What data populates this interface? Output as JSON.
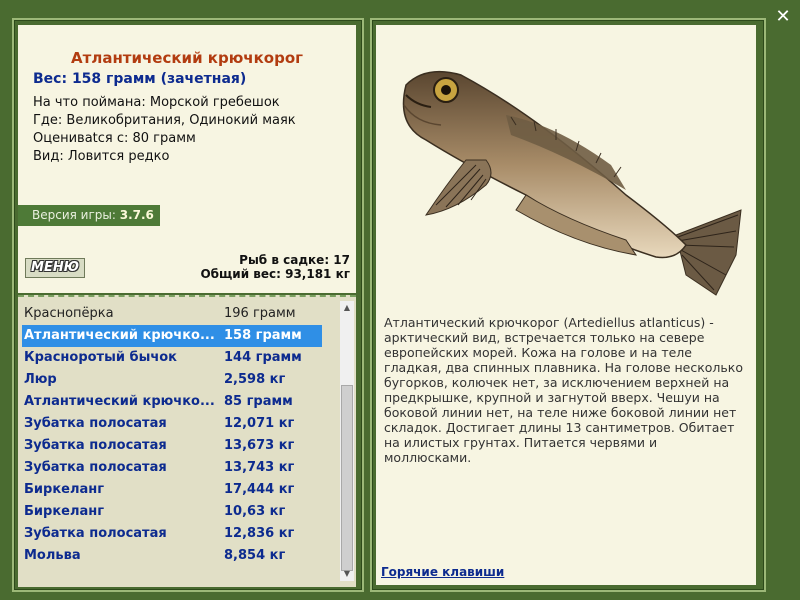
{
  "info": {
    "title": "Атлантический крючкорог",
    "weight": "Вес: 158 грамм (зачетная)",
    "caught_on": "На что поймана: Морской гребешок",
    "location": "Где: Великобритания, Одинокий маяк",
    "min_weight": "Оцениваtся с: 80 грамм",
    "kind": "Вид: Ловится редко"
  },
  "version": {
    "label": "Версия игры:",
    "value": "3.7.6"
  },
  "menu_button": "МЕНЮ",
  "stats": {
    "fish_in_cage": "Рыб в садке: 17",
    "total_weight": "Общий вес: 93,181 кг"
  },
  "catch_list": [
    {
      "name": "Краснопёрка",
      "weight": "196 грамм"
    },
    {
      "name": "Атлантический крючко...",
      "weight": "158 грамм"
    },
    {
      "name": "Красноротый бычок",
      "weight": "144 грамм"
    },
    {
      "name": "Люр",
      "weight": "2,598 кг"
    },
    {
      "name": "Атлантический крючко...",
      "weight": "85 грамм"
    },
    {
      "name": "Зубатка полосатая",
      "weight": "12,071 кг"
    },
    {
      "name": "Зубатка полосатая",
      "weight": "13,673 кг"
    },
    {
      "name": "Зубатка полосатая",
      "weight": "13,743 кг"
    },
    {
      "name": "Биркеланг",
      "weight": "17,444 кг"
    },
    {
      "name": "Биркеланг",
      "weight": "10,63 кг"
    },
    {
      "name": "Зубатка полосатая",
      "weight": "12,836 кг"
    },
    {
      "name": "Мольва",
      "weight": "8,854 кг"
    }
  ],
  "description": "Атлантический крючкорог (Artediellus atlanticus) - арктический вид, встречается только на севере европейских морей. Кожа на голове и на теле гладкая, два спинных плавника. На голове несколько бугорков, колючек нет, за исключением верхней на предкрышке, крупной и загнутой вверх. Чешуи на боковой линии нет, на теле ниже боковой линии нет складок. Достигает длины 13 сантиметров. Обитает на илистых грунтах. Питается червями и моллюсками.",
  "hotkeys": "Горячие клавиши",
  "close_icon": "✕",
  "colors": {
    "background": "#4a6b30",
    "panel": "#f7f5e2",
    "list_bg": "#e1dfc6",
    "title": "#b23c10",
    "accent": "#0d2b8f",
    "selection": "#2f8fe6"
  }
}
